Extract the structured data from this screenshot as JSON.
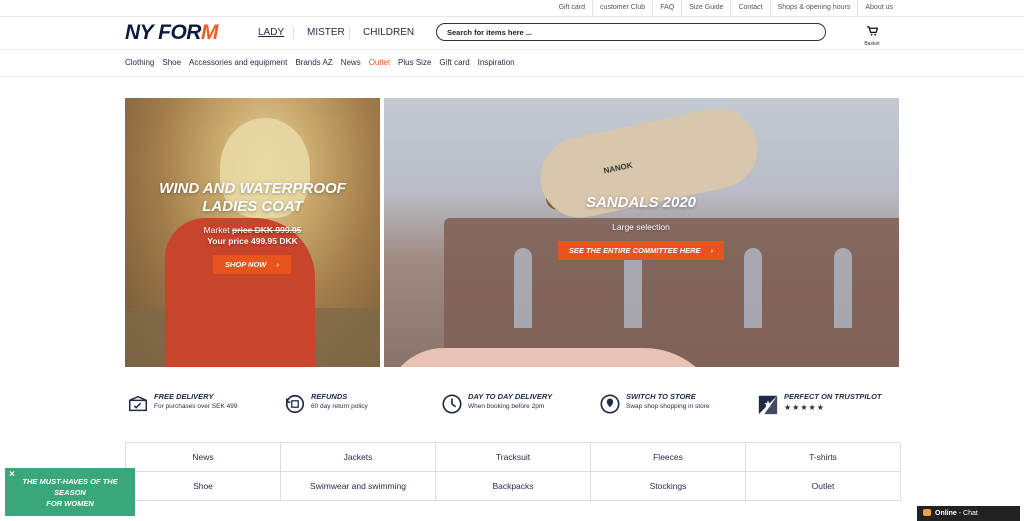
{
  "util_links": [
    "Gift card",
    "customer Club",
    "FAQ",
    "Size Guide",
    "Contact",
    "Shops & opening hours",
    "About us"
  ],
  "logo": {
    "text": "NY FOR",
    "accent": "M"
  },
  "genders": [
    "LADY",
    "MISTER",
    "CHILDREN"
  ],
  "search": {
    "placeholder": "Search for items here ..."
  },
  "basket": {
    "label": "Basket",
    "icon": "cart-icon"
  },
  "categories": [
    "Clothing",
    "Shoe",
    "Accessories and equipment",
    "Brands AZ",
    "News",
    "Outlet",
    "Plus Size",
    "Gift card",
    "Inspiration"
  ],
  "hero_left": {
    "title_line1": "WIND AND WATERPROOF",
    "title_line2": "LADIES COAT",
    "market_label": "Market",
    "market_price": "price DKK 999.95",
    "your_price": "Your price 499.95 DKK",
    "button": "SHOP NOW",
    "button_arrow": "›"
  },
  "hero_right": {
    "title": "SANDALS 2020",
    "subtitle": "Large selection",
    "button": "SEE THE ENTIRE COMMITTEE HERE",
    "button_arrow": "›",
    "brand_on_sandal": "NANOK"
  },
  "usps": [
    {
      "icon": "delivery-box-icon",
      "title": "FREE DELIVERY",
      "sub": "For purchases over SEK 499"
    },
    {
      "icon": "refund-icon",
      "title": "REFUNDS",
      "sub": "60 day return policy"
    },
    {
      "icon": "clock-icon",
      "title": "DAY TO DAY DELIVERY",
      "sub": "When booking before 2pm"
    },
    {
      "icon": "store-pin-icon",
      "title": "SWITCH TO STORE",
      "sub": "Swap shop shopping in store"
    },
    {
      "icon": "trustpilot-icon",
      "title": "PERFECT ON TRUSTPILOT",
      "sub": "★★★★★"
    }
  ],
  "grid": [
    [
      "News",
      "Jackets",
      "Tracksuit",
      "Fleeces",
      "T-shirts"
    ],
    [
      "Shoe",
      "Swimwear and swimming",
      "Backpacks",
      "Stockings",
      "Outlet"
    ]
  ],
  "promo": {
    "close": "×",
    "line1": "THE MUST-HAVES OF THE",
    "line2": "SEASON",
    "line3": "FOR WOMEN"
  },
  "chat": {
    "status": "Online",
    "label": "Chat",
    "sep": "-"
  },
  "colors": {
    "accent": "#e8541e",
    "navy": "#0f1b3d",
    "promo": "#3aa77a"
  }
}
